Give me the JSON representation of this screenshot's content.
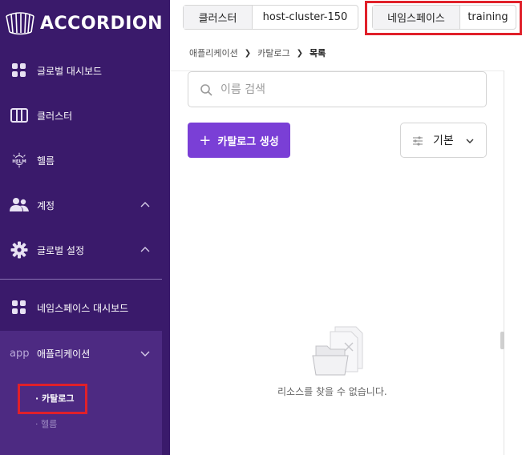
{
  "app": {
    "logo_text": "ACCORDION"
  },
  "header": {
    "cluster_label": "클러스터",
    "cluster_value": "host-cluster-150",
    "namespace_label": "네임스페이스",
    "namespace_value": "training"
  },
  "sidebar": {
    "items": [
      {
        "label": "글로벌 대시보드",
        "icon": "grid-icon"
      },
      {
        "label": "클러스터",
        "icon": "columns-icon"
      },
      {
        "label": "헬름",
        "icon": "helm-icon",
        "icon_text": "HELM"
      },
      {
        "label": "계정",
        "icon": "users-icon",
        "expandable": true
      },
      {
        "label": "글로벌 설정",
        "icon": "gear-icon",
        "expandable": true
      },
      {
        "label": "네임스페이스 대시보드",
        "icon": "grid-icon"
      }
    ],
    "app_section": {
      "icon_text": "app",
      "label": "애플리케이션",
      "children": [
        {
          "label": "· 카탈로그",
          "active": true
        },
        {
          "label": "· 헬름",
          "active": false
        }
      ]
    }
  },
  "breadcrumb": [
    "애플리케이션",
    "카탈로그",
    "목록"
  ],
  "search": {
    "placeholder": "이름 검색"
  },
  "actions": {
    "create_label": "카탈로그 생성",
    "sort_label": "기본"
  },
  "empty_state": {
    "message": "리소스를 찾을 수 없습니다."
  },
  "colors": {
    "sidebar_bg": "#3a1a6b",
    "accent": "#7a3fd6",
    "highlight": "#e0202a"
  }
}
